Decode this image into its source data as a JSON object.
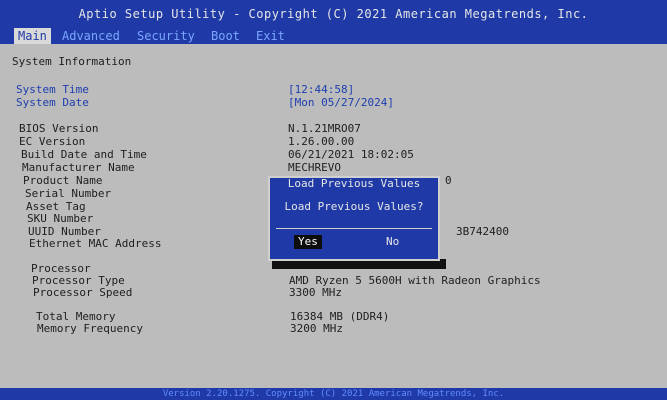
{
  "header": {
    "title": "Aptio Setup Utility - Copyright (C) 2021 American Megatrends, Inc."
  },
  "tabs": [
    {
      "label": "Main"
    },
    {
      "label": "Advanced"
    },
    {
      "label": "Security"
    },
    {
      "label": "Boot"
    },
    {
      "label": "Exit"
    }
  ],
  "main": {
    "section_title": "System Information",
    "system_time_label": "System Time",
    "system_time_value": "[12:44:58]",
    "system_date_label": "System Date",
    "system_date_value": "[Mon 05/27/2024]",
    "bios_version_label": "BIOS Version",
    "bios_version_value": "N.1.21MRO07",
    "ec_version_label": "EC Version",
    "ec_version_value": "1.26.00.00",
    "build_label": "Build Date and Time",
    "build_value": "06/21/2021 18:02:05",
    "manufacturer_label": "Manufacturer Name",
    "manufacturer_value": "MECHREVO",
    "product_label": "Product Name",
    "product_value_fragment": "0",
    "serial_label": "Serial Number",
    "asset_label": "Asset Tag",
    "sku_label": "SKU Number",
    "uuid_label": "UUID Number",
    "uuid_value_fragment": "3B742400",
    "mac_label": "Ethernet MAC Address",
    "processor_label": "Processor",
    "processor_type_label": "Processor Type",
    "processor_type_value": "AMD Ryzen 5 5600H with Radeon Graphics",
    "processor_speed_label": "Processor Speed",
    "processor_speed_value": "3300 MHz",
    "total_memory_label": "Total Memory",
    "total_memory_value": "16384 MB (DDR4)",
    "memory_freq_label": "Memory Frequency",
    "memory_freq_value": "3200 MHz"
  },
  "dialog": {
    "title": "Load Previous Values",
    "message": "Load Previous Values?",
    "yes_label": "Yes",
    "no_label": "No"
  },
  "footer": {
    "version": "Version 2.20.1275. Copyright (C) 2021 American Megatrends, Inc."
  }
}
